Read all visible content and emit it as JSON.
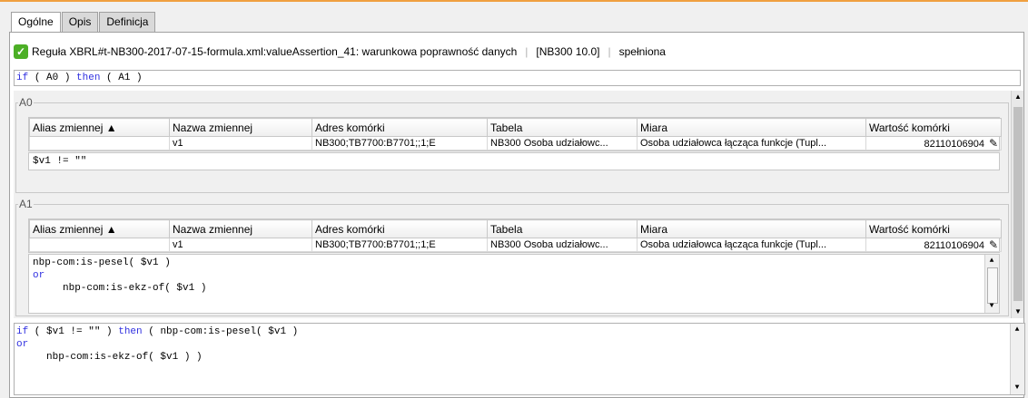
{
  "tabs": [
    {
      "label": "Ogólne",
      "active": true
    },
    {
      "label": "Opis",
      "active": false
    },
    {
      "label": "Definicja",
      "active": false
    }
  ],
  "status": {
    "icon": "check-icon",
    "rule": "Reguła XBRL#t-NB300-2017-07-15-formula.xml:valueAssertion_41: warunkowa poprawność danych",
    "report": "[NB300 10.0]",
    "result": "spełniona"
  },
  "expression": {
    "if": "if",
    "cond": "( A0 )",
    "then": "then",
    "body": "( A1 )"
  },
  "columns": [
    "Alias zmiennej ▲",
    "Nazwa zmiennej",
    "Adres komórki",
    "Tabela",
    "Miara",
    "Wartość komórki"
  ],
  "a0": {
    "legend": "A0",
    "row": {
      "alias": "",
      "name": "v1",
      "address": "NB300;TB7700:B7701;;1;E",
      "table": "NB300 Osoba udziałowc...",
      "measure": "Osoba udziałowca łącząca funkcje (Tupl...",
      "value": "82110106904"
    },
    "code": "$v1 != \"\""
  },
  "a1": {
    "legend": "A1",
    "row": {
      "alias": "",
      "name": "v1",
      "address": "NB300;TB7700:B7701;;1;E",
      "table": "NB300 Osoba udziałowc...",
      "measure": "Osoba udziałowca łącząca funkcje (Tupl...",
      "value": "82110106904"
    },
    "code_line1": "nbp-com:is-pesel( $v1 )",
    "code_or": "or",
    "code_line3": "     nbp-com:is-ekz-of( $v1 )"
  },
  "bottom": {
    "if": "if",
    "cond": " ( $v1 != \"\" ) ",
    "then": "then",
    "body": " ( nbp-com:is-pesel( $v1 )",
    "or": "or",
    "line3": "     nbp-com:is-ekz-of( $v1 ) )"
  }
}
